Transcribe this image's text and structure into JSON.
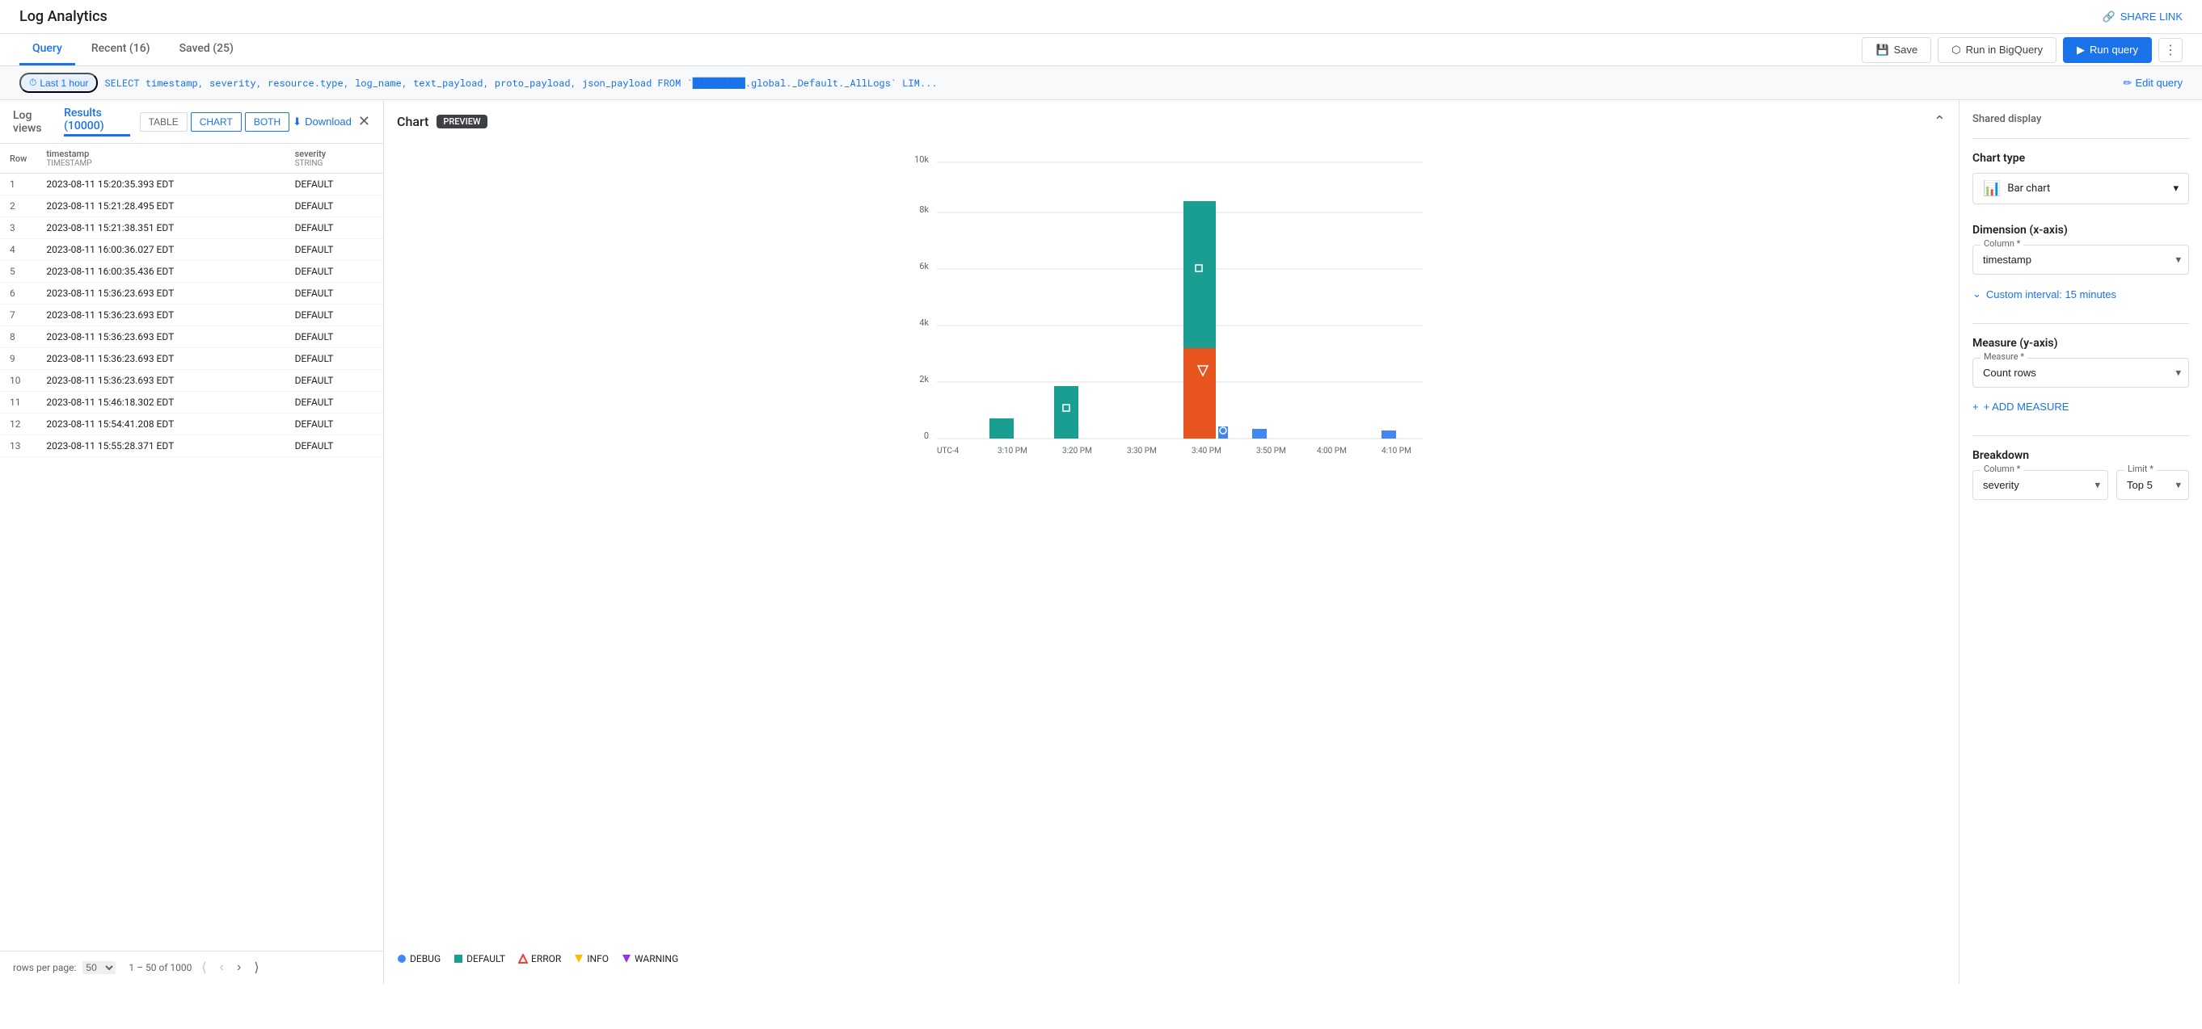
{
  "app": {
    "title": "Log Analytics",
    "share_link_label": "SHARE LINK"
  },
  "nav": {
    "tabs": [
      {
        "id": "query",
        "label": "Query",
        "active": true
      },
      {
        "id": "recent",
        "label": "Recent (16)",
        "active": false
      },
      {
        "id": "saved",
        "label": "Saved (25)",
        "active": false
      }
    ],
    "actions": {
      "save": "Save",
      "run_bigquery": "Run in BigQuery",
      "run_query": "Run query"
    }
  },
  "query_bar": {
    "time_label": "Last 1 hour",
    "query_text": "SELECT timestamp, severity, resource.type, log_name, text_payload, proto_payload, json_payload FROM `█████████.global._Default._AllLogs` LIM...",
    "edit_label": "Edit query"
  },
  "results_header": {
    "log_views_label": "Log views",
    "results_tab": "Results (10000)",
    "view_buttons": [
      "TABLE",
      "CHART",
      "BOTH"
    ],
    "active_view": "BOTH",
    "download_label": "Download"
  },
  "table": {
    "columns": [
      {
        "id": "row",
        "label": "Row",
        "type": ""
      },
      {
        "id": "timestamp",
        "label": "timestamp",
        "type": "TIMESTAMP"
      },
      {
        "id": "severity",
        "label": "severity",
        "type": "STRING"
      }
    ],
    "rows": [
      {
        "row": "1",
        "timestamp": "2023-08-11 15:20:35.393 EDT",
        "severity": "DEFAULT"
      },
      {
        "row": "2",
        "timestamp": "2023-08-11 15:21:28.495 EDT",
        "severity": "DEFAULT"
      },
      {
        "row": "3",
        "timestamp": "2023-08-11 15:21:38.351 EDT",
        "severity": "DEFAULT"
      },
      {
        "row": "4",
        "timestamp": "2023-08-11 16:00:36.027 EDT",
        "severity": "DEFAULT"
      },
      {
        "row": "5",
        "timestamp": "2023-08-11 16:00:35.436 EDT",
        "severity": "DEFAULT"
      },
      {
        "row": "6",
        "timestamp": "2023-08-11 15:36:23.693 EDT",
        "severity": "DEFAULT"
      },
      {
        "row": "7",
        "timestamp": "2023-08-11 15:36:23.693 EDT",
        "severity": "DEFAULT"
      },
      {
        "row": "8",
        "timestamp": "2023-08-11 15:36:23.693 EDT",
        "severity": "DEFAULT"
      },
      {
        "row": "9",
        "timestamp": "2023-08-11 15:36:23.693 EDT",
        "severity": "DEFAULT"
      },
      {
        "row": "10",
        "timestamp": "2023-08-11 15:36:23.693 EDT",
        "severity": "DEFAULT"
      },
      {
        "row": "11",
        "timestamp": "2023-08-11 15:46:18.302 EDT",
        "severity": "DEFAULT"
      },
      {
        "row": "12",
        "timestamp": "2023-08-11 15:54:41.208 EDT",
        "severity": "DEFAULT"
      },
      {
        "row": "13",
        "timestamp": "2023-08-11 15:55:28.371 EDT",
        "severity": "DEFAULT"
      }
    ]
  },
  "pagination": {
    "rows_per_page_label": "rows per page:",
    "page_size": "50",
    "range_text": "1 – 50 of 1000"
  },
  "chart": {
    "title": "Chart",
    "preview_label": "PREVIEW",
    "x_labels": [
      "UTC-4",
      "3:10 PM",
      "3:20 PM",
      "3:30 PM",
      "3:40 PM",
      "3:50 PM",
      "4:00 PM",
      "4:10 PM"
    ],
    "y_labels": [
      "0",
      "2k",
      "4k",
      "6k",
      "8k",
      "10k"
    ],
    "legend": [
      {
        "id": "debug",
        "label": "DEBUG",
        "color": "#4285f4",
        "shape": "circle"
      },
      {
        "id": "default",
        "label": "DEFAULT",
        "color": "#1a9e91",
        "shape": "square"
      },
      {
        "id": "error",
        "label": "ERROR",
        "color": "#ea4335",
        "shape": "diamond"
      },
      {
        "id": "info",
        "label": "INFO",
        "color": "#fbbc04",
        "shape": "triangle-down"
      },
      {
        "id": "warning",
        "label": "WARNING",
        "color": "#9334e6",
        "shape": "triangle-up"
      }
    ],
    "bars": [
      {
        "x_label": "3:10 PM",
        "segments": [
          {
            "color": "#1a9e91",
            "value": 600,
            "icon": null
          }
        ]
      },
      {
        "x_label": "3:20 PM",
        "segments": [
          {
            "color": "#1a9e91",
            "value": 1800,
            "icon": "square"
          }
        ]
      },
      {
        "x_label": "3:40 PM",
        "segments": [
          {
            "color": "#ea4335",
            "value": 3200,
            "icon": "triangle-down"
          },
          {
            "color": "#1a9e91",
            "value": 5200,
            "icon": "square"
          }
        ]
      },
      {
        "x_label": "3:50 PM",
        "segments": [
          {
            "color": "#4285f4",
            "value": 120,
            "icon": null
          }
        ]
      },
      {
        "x_label": "4:10 PM",
        "segments": [
          {
            "color": "#4285f4",
            "value": 80,
            "icon": null
          }
        ]
      },
      {
        "x_label": "3:40 PM bottom",
        "segments": [
          {
            "color": "#4285f4",
            "value": 200,
            "icon": "circle"
          }
        ]
      }
    ]
  },
  "config": {
    "shared_display_title": "Shared display",
    "chart_type_label": "Chart type",
    "chart_type_value": "Bar chart",
    "chart_type_icon": "bar-chart",
    "dimension_label": "Dimension (x-axis)",
    "dimension_column_label": "Column *",
    "dimension_column_value": "timestamp",
    "custom_interval_label": "Custom interval: 15 minutes",
    "measure_label": "Measure (y-axis)",
    "measure_field_label": "Measure *",
    "measure_value": "Count rows",
    "add_measure_label": "+ ADD MEASURE",
    "breakdown_label": "Breakdown",
    "breakdown_column_label": "Column *",
    "breakdown_column_value": "severity",
    "breakdown_limit_label": "Limit *",
    "breakdown_limit_value": "Top 5"
  },
  "icons": {
    "clock": "⏱",
    "pencil": "✏",
    "download": "⬇",
    "close": "✕",
    "chevron_down": "▾",
    "chevron_right": "›",
    "play": "▶",
    "link": "🔗",
    "save": "💾",
    "bar_chart": "📊",
    "first_page": "⟨⟨",
    "prev_page": "‹",
    "next_page": "›",
    "last_page": "⟩⟩",
    "expand": "⌃",
    "plus": "+"
  }
}
